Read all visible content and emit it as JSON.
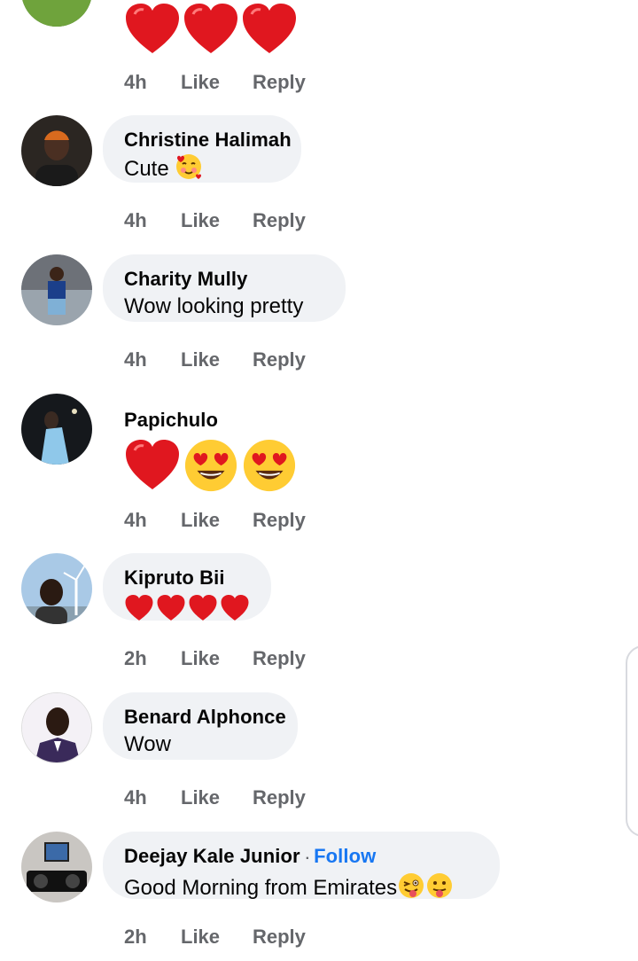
{
  "actions": {
    "like": "Like",
    "reply": "Reply"
  },
  "comments": [
    {
      "name": "",
      "text": "",
      "emoji": [
        "red-heart",
        "red-heart",
        "red-heart"
      ],
      "time": "4h"
    },
    {
      "name": "Christine Halimah",
      "text": "Cute",
      "emoji": [
        "smiling-face-with-hearts"
      ],
      "time": "4h"
    },
    {
      "name": "Charity Mully",
      "text": "Wow looking pretty",
      "emoji": [],
      "time": "4h"
    },
    {
      "name": "Papichulo",
      "text": "",
      "emoji": [
        "red-heart",
        "heart-eyes",
        "heart-eyes"
      ],
      "time": "4h"
    },
    {
      "name": "Kipruto Bii",
      "text": "",
      "emoji": [
        "red-heart",
        "red-heart",
        "red-heart",
        "red-heart"
      ],
      "time": "2h"
    },
    {
      "name": "Benard Alphonce",
      "text": "Wow",
      "emoji": [],
      "time": "4h"
    },
    {
      "name": "Deejay Kale Junior",
      "follow": "Follow",
      "text": "Good Morning from Emirates",
      "emoji": [
        "winking-face-with-tongue",
        "face-with-tongue"
      ],
      "time": "2h"
    }
  ],
  "colors": {
    "bubble": "#f0f2f5",
    "meta": "#65676b",
    "follow": "#1877f2",
    "heart": "#e0171f"
  }
}
